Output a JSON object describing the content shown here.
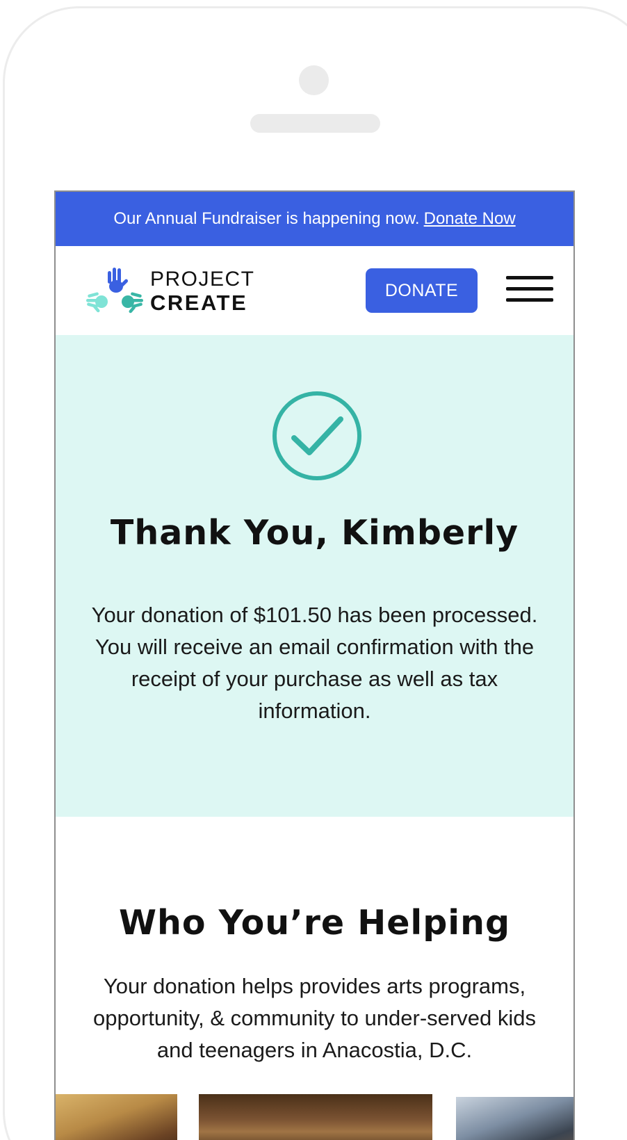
{
  "announcement": {
    "text": "Our Annual Fundraiser is happening now.",
    "link": "Donate Now"
  },
  "header": {
    "logo_line1": "PROJECT",
    "logo_line2": "CREATE",
    "donate_label": "DONATE"
  },
  "confirmation": {
    "title": "Thank You, Kimberly",
    "message": "Your donation of $101.50 has been processed. You will receive an email confirmation with the receipt of your purchase as well as tax information."
  },
  "helping": {
    "title": "Who You’re Helping",
    "description": "Your donation helps provides arts programs, opportunity, & community to under-served kids and teenagers in Anacostia, D.C."
  },
  "colors": {
    "brand_blue": "#3a60e1",
    "mint_background": "#ddf7f3",
    "check_teal": "#35b3a5",
    "hand_blue": "#3a60e1",
    "hand_teal": "#39b6a6",
    "hand_mint": "#7fe3d6"
  },
  "icons": {
    "check": "check-circle-icon",
    "menu": "hamburger-menu-icon",
    "logo": "hands-logo-icon"
  }
}
